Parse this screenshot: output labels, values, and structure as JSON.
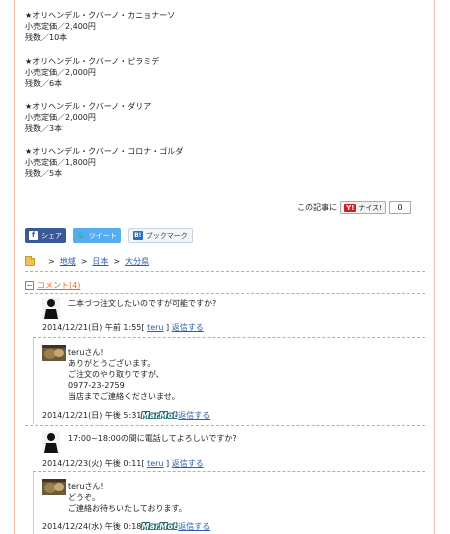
{
  "products": [
    {
      "name": "★オリヘンデル・クバーノ・カニョナーソ",
      "price": "小売定価／2,400円",
      "stock": "残数／10本"
    },
    {
      "name": "★オリヘンデル・クバーノ・ピラミデ",
      "price": "小売定価／2,000円",
      "stock": "残数／6本"
    },
    {
      "name": "★オリヘンデル・クバーノ・ダリア",
      "price": "小売定価／2,000円",
      "stock": "残数／3本"
    },
    {
      "name": "★オリヘンデル・クバーノ・コロナ・ゴルダ",
      "price": "小売定価／1,800円",
      "stock": "残数／5本"
    }
  ],
  "naisu": {
    "label": "この記事に",
    "logo": "Y!",
    "button": "ナイス!",
    "count": "0"
  },
  "share": {
    "facebook": "シェア",
    "twitter": "ツイート",
    "hatena": "ブックマーク",
    "hatena_icon": "B!",
    "fb_icon": "f",
    "tw_icon": "🐦"
  },
  "breadcrumb": {
    "sep": ">",
    "items": [
      "地域",
      "日本",
      "大分県"
    ]
  },
  "comments_title": "コメント(4)",
  "comments": [
    {
      "lines": [
        "二本づつ注文したいのですが可能ですか?"
      ],
      "date": "2014/12/21(日) 午前 1:55",
      "open": "[",
      "user": "teru",
      "close": "]",
      "reply": "返信する"
    },
    {
      "lines": [
        "teruさん!",
        "ありがとうございます。",
        "ご注文のやり取りですが、",
        "0977-23-2759",
        "当店までご連絡くださいませ。"
      ],
      "date": "2014/12/21(日) 午後 5:31",
      "user": "MarMot",
      "reply": "返信する"
    },
    {
      "lines": [
        "17:00~18:00の間に電話してよろしいですか?"
      ],
      "date": "2014/12/23(火) 午後 0:11",
      "open": "[",
      "user": "teru",
      "close": "]",
      "reply": "返信する"
    },
    {
      "lines": [
        "teruさん!",
        "どうぞ。",
        "ご連絡お待ちいたしております。"
      ],
      "date": "2014/12/24(水) 午後 0:18",
      "user": "MarMot",
      "reply": "返信する"
    }
  ]
}
